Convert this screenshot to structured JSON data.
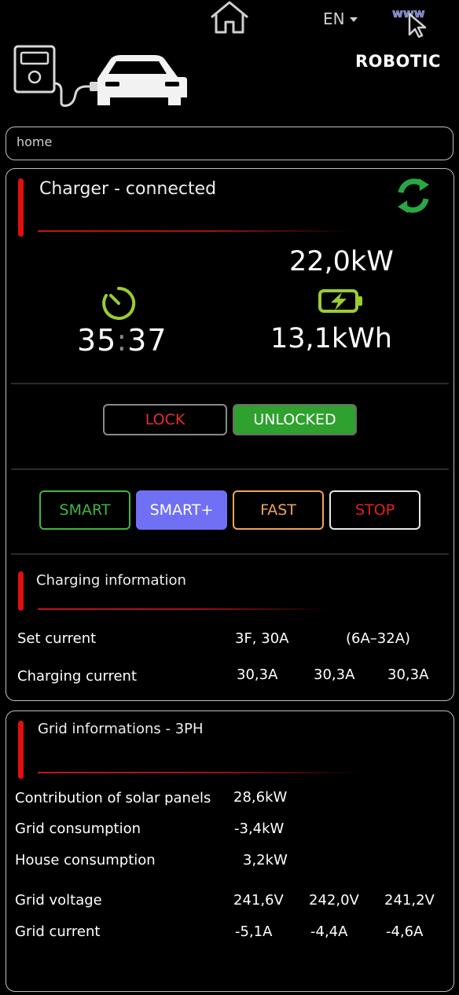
{
  "nav": {
    "home_icon": "home-icon",
    "language": "EN",
    "www_icon": "www-cursor-icon",
    "brand": "ROBOTIC"
  },
  "breadcrumb": "home",
  "charger": {
    "title": "Charger -  connected",
    "refresh_icon": "refresh-icon",
    "timer_minutes": "35",
    "timer_colon": ":",
    "timer_seconds": "37",
    "power": "22,0kW",
    "energy": "13,1kWh",
    "lock_label": "LOCK",
    "unlocked_label": "UNLOCKED",
    "modes": {
      "smart": "SMART",
      "smart_plus": "SMART+",
      "fast": "FAST",
      "stop": "STOP"
    }
  },
  "charging_info": {
    "title": "Charging information",
    "set_current_label": "Set current",
    "set_current_value": "3F, 30A",
    "set_current_range": "(6A–32A)",
    "charging_current_label": "Charging current",
    "charging_current_values": [
      "30,3A",
      "30,3A",
      "30,3A"
    ]
  },
  "grid_info": {
    "title": "Grid informations - 3PH",
    "solar_label": "Contribution of solar panels",
    "solar_value": "28,6kW",
    "grid_consumption_label": "Grid consumption",
    "grid_consumption_value": "-3,4kW",
    "house_consumption_label": "House consumption",
    "house_consumption_value": "3,2kW",
    "grid_voltage_label": "Grid voltage",
    "grid_voltage_values": [
      "241,6V",
      "242,0V",
      "241,2V"
    ],
    "grid_current_label": "Grid current",
    "grid_current_values": [
      "-5,1A",
      "-4,4A",
      "-4,6A"
    ]
  },
  "colors": {
    "accent_red": "#e01010",
    "green": "#2ea12e",
    "smart_green": "#3fb63f",
    "smart_plus_purple": "#7070f5",
    "fast_orange": "#f0a455",
    "timer_icon_green": "#9acd32"
  }
}
